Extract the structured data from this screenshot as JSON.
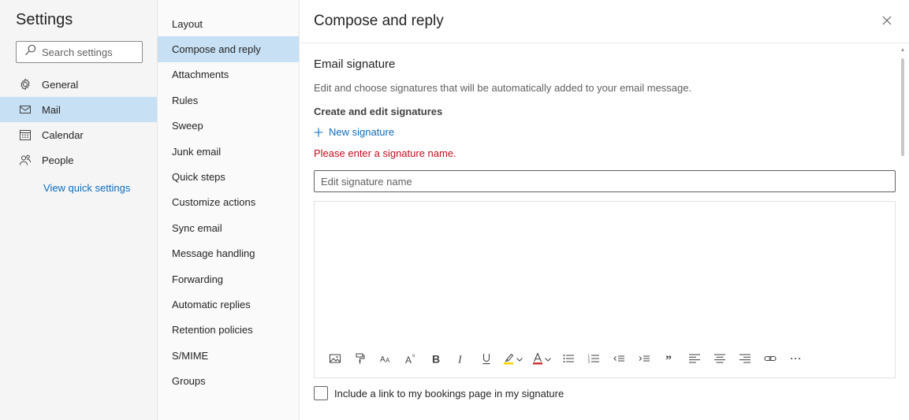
{
  "settings": {
    "title": "Settings",
    "search_placeholder": "Search settings",
    "nav": [
      {
        "label": "General",
        "icon": "gear-icon"
      },
      {
        "label": "Mail",
        "icon": "mail-icon"
      },
      {
        "label": "Calendar",
        "icon": "calendar-icon"
      },
      {
        "label": "People",
        "icon": "people-icon"
      }
    ],
    "active_nav": "Mail",
    "quick_settings_link": "View quick settings"
  },
  "mail_nav": {
    "items": [
      "Layout",
      "Compose and reply",
      "Attachments",
      "Rules",
      "Sweep",
      "Junk email",
      "Quick steps",
      "Customize actions",
      "Sync email",
      "Message handling",
      "Forwarding",
      "Automatic replies",
      "Retention policies",
      "S/MIME",
      "Groups"
    ],
    "active": "Compose and reply"
  },
  "panel": {
    "title": "Compose and reply",
    "section_title": "Email signature",
    "section_description": "Edit and choose signatures that will be automatically added to your email message.",
    "subheading": "Create and edit signatures",
    "new_signature_label": "New signature",
    "error_message": "Please enter a signature name.",
    "signature_name_placeholder": "Edit signature name",
    "signature_name_value": "",
    "toolbar_icons": [
      "insert-picture-icon",
      "format-painter-icon",
      "font-size-icon",
      "superscript-icon",
      "bold-icon",
      "italic-icon",
      "underline-icon",
      "highlight-icon",
      "font-color-icon",
      "bullets-icon",
      "numbering-icon",
      "decrease-indent-icon",
      "increase-indent-icon",
      "quote-icon",
      "align-left-icon",
      "align-center-icon",
      "align-right-icon",
      "link-icon",
      "more-icon"
    ],
    "bookings_checkbox_label": "Include a link to my bookings page in my signature",
    "bookings_checked": false
  },
  "colors": {
    "accent": "#0f6cbd",
    "selected_bg": "#c7e0f4",
    "error": "#c50f1f",
    "highlight_yellow": "#ffd400",
    "font_color_red": "#d13438"
  }
}
